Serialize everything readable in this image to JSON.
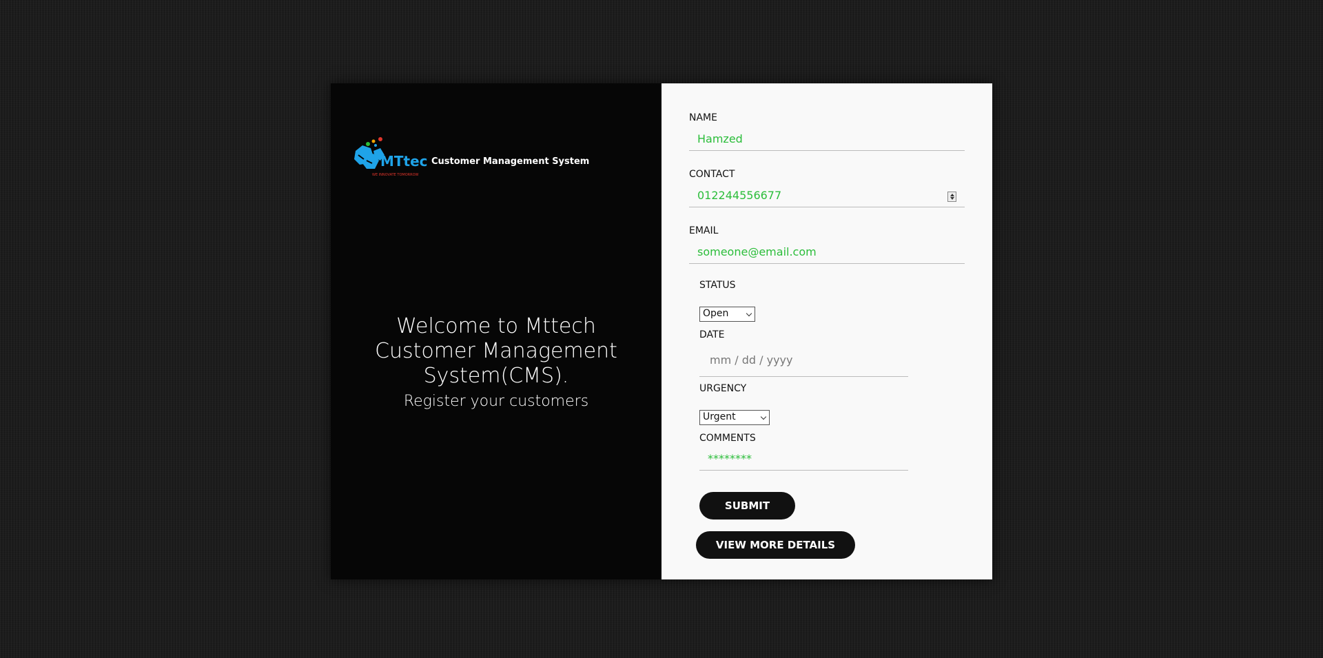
{
  "brand": {
    "logo_text": "MTtech",
    "logo_tagline": "WE INNOVATE TOMORROW",
    "title": "Customer Management System"
  },
  "welcome": {
    "title": "Welcome to Mttech Customer Management System(CMS).",
    "subtitle": "Register your customers"
  },
  "form": {
    "name": {
      "label": "NAME",
      "value": "Hamzed"
    },
    "contact": {
      "label": "CONTACT",
      "value": "012244556677"
    },
    "email": {
      "label": "EMAIL",
      "value": "someone@email.com"
    },
    "status": {
      "label": "STATUS",
      "selected": "Open"
    },
    "date": {
      "label": "DATE",
      "placeholder": "mm / dd / yyyy"
    },
    "urgency": {
      "label": "URGENCY",
      "selected": "Urgent"
    },
    "comments": {
      "label": "COMMENTS",
      "value": "********"
    },
    "submit_label": "SUBMIT",
    "view_more_label": "VIEW MORE DETAILS"
  },
  "colors": {
    "input_text": "#2bbd3a",
    "logo_blue": "#1fa3e8",
    "logo_red": "#e0352b"
  }
}
